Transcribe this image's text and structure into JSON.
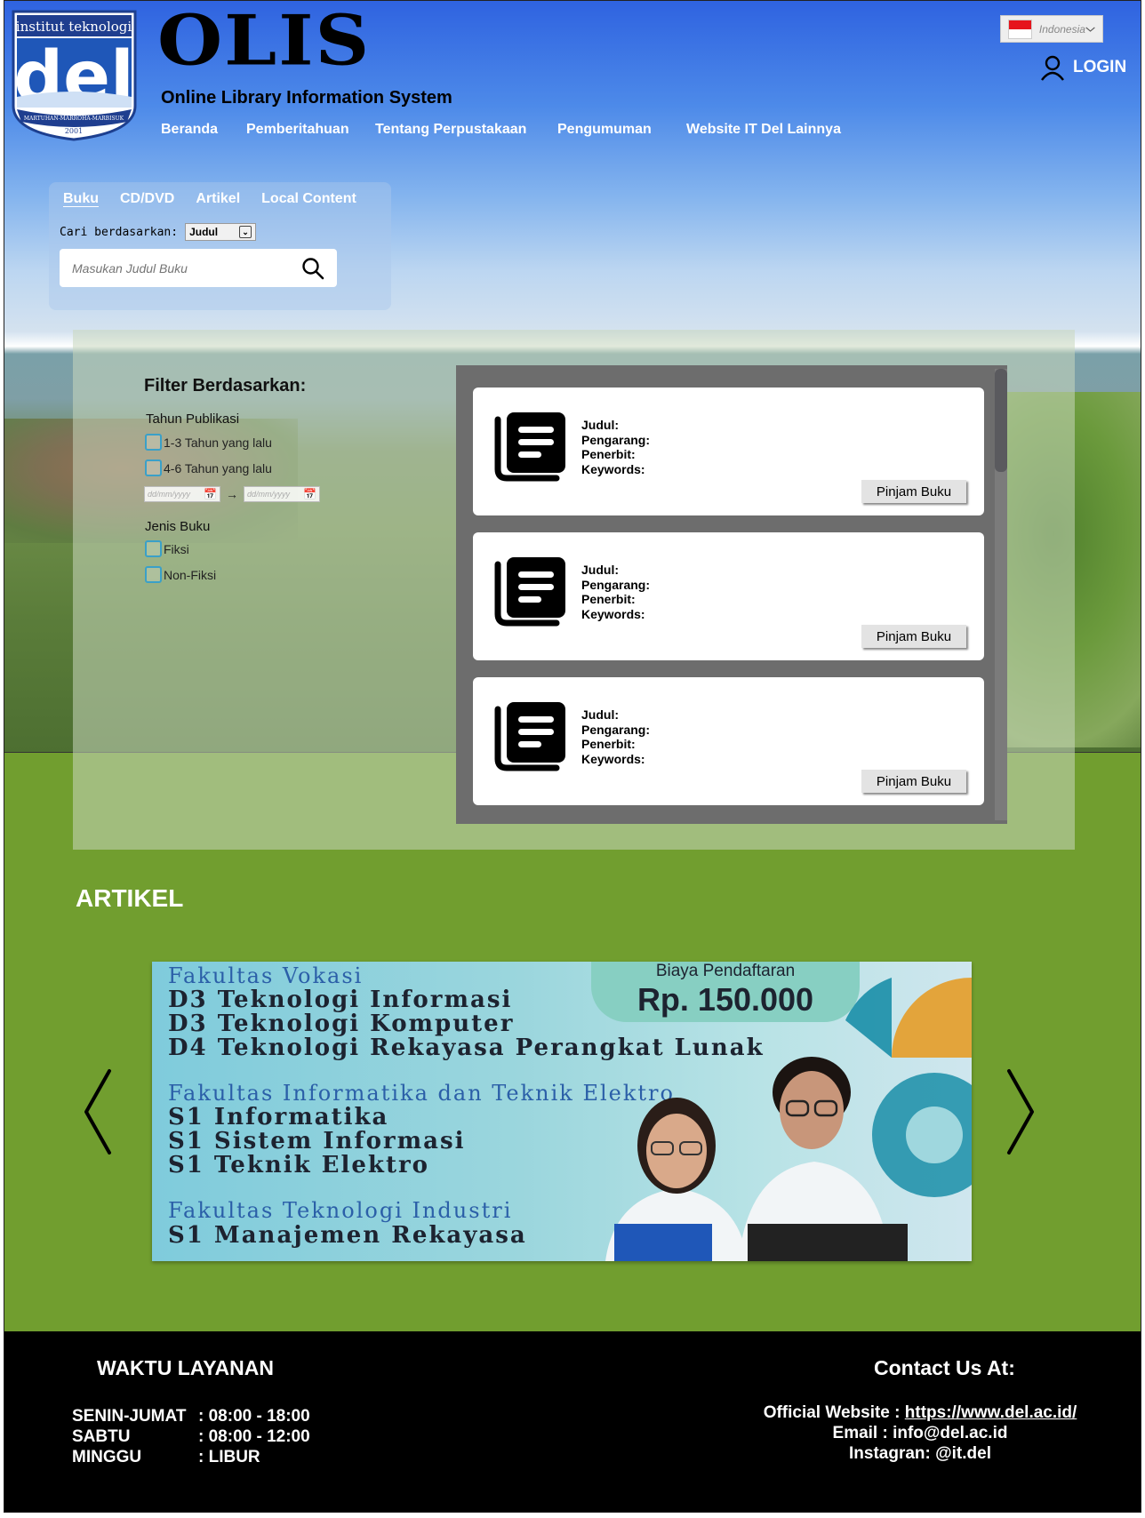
{
  "header": {
    "logo_text_top": "institut teknologi",
    "logo_text_main": "del",
    "logo_text_motto": "MARTUHAN-MARROHA-MARBISUK",
    "logo_text_year": "2001",
    "brand_title": "OLIS",
    "brand_subtitle": "Online Library Information System",
    "nav": [
      {
        "label": "Beranda"
      },
      {
        "label": "Pemberitahuan"
      },
      {
        "label": "Tentang Perpustakaan"
      },
      {
        "label": "Pengumuman"
      },
      {
        "label": "Website IT Del Lainnya"
      }
    ],
    "language": "Indonesia",
    "login_label": "LOGIN"
  },
  "search": {
    "tabs": [
      "Buku",
      "CD/DVD",
      "Artikel",
      "Local Content"
    ],
    "active_tab": "Buku",
    "search_by_label": "Cari berdasarkan:",
    "search_by_value": "Judul",
    "placeholder": "Masukan Judul Buku"
  },
  "filter": {
    "title": "Filter Berdasarkan:",
    "year_label": "Tahun Publikasi",
    "year_options": [
      "1-3 Tahun yang lalu",
      "4-6 Tahun yang lalu"
    ],
    "date_placeholder": "dd/mm/yyyy",
    "type_label": "Jenis Buku",
    "type_options": [
      "Fiksi",
      "Non-Fiksi"
    ]
  },
  "results": {
    "fields": [
      "Judul:",
      "Pengarang:",
      "Penerbit:",
      "Keywords:"
    ],
    "button_label": "Pinjam Buku",
    "cards": [
      {
        "judul": "",
        "pengarang": "",
        "penerbit": "",
        "keywords": ""
      },
      {
        "judul": "",
        "pengarang": "",
        "penerbit": "",
        "keywords": ""
      },
      {
        "judul": "",
        "pengarang": "",
        "penerbit": "",
        "keywords": ""
      }
    ]
  },
  "artikel": {
    "title": "ARTIKEL",
    "banner": {
      "fee_label": "Biaya Pendaftaran",
      "fee_value": "Rp. 150.000",
      "faculties": [
        {
          "name": "Fakultas Vokasi",
          "programs": [
            "D3 Teknologi Informasi",
            "D3 Teknologi Komputer",
            "D4 Teknologi Rekayasa Perangkat Lunak"
          ]
        },
        {
          "name": "Fakultas Informatika dan Teknik Elektro",
          "programs": [
            "S1 Informatika",
            "S1 Sistem Informasi",
            "S1 Teknik Elektro"
          ]
        },
        {
          "name": "Fakultas Teknologi Industri",
          "programs": [
            "S1 Manajemen Rekayasa"
          ]
        }
      ]
    }
  },
  "footer": {
    "service_title": "WAKTU LAYANAN",
    "hours": [
      {
        "day": "SENIN-JUMAT",
        "time": ": 08:00 - 18:00"
      },
      {
        "day": "SABTU",
        "time": ": 08:00 - 12:00"
      },
      {
        "day": "MINGGU",
        "time": " : LIBUR"
      }
    ],
    "contact_title": "Contact Us At:",
    "website_label": "Official Website : ",
    "website_url": "https://www.del.ac.id/",
    "email": "Email : info@del.ac.id",
    "instagram": "Instagran: @it.del"
  },
  "colors": {
    "header_blue": "#2f63e0",
    "green_section": "#719e2f",
    "footer_bg": "#000000",
    "results_bg": "#6d6d6d",
    "checkbox_border": "#3aa0c8"
  }
}
